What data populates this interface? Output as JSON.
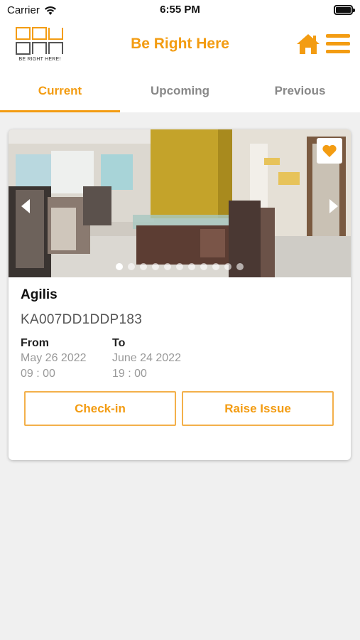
{
  "status_bar": {
    "carrier": "Carrier",
    "time": "6:55 PM"
  },
  "header": {
    "logo_caption": "BE RIGHT HERE!",
    "title": "Be Right Here",
    "home_icon": "home-icon",
    "menu_icon": "hamburger-menu-icon"
  },
  "tabs": [
    {
      "label": "Current",
      "active": true
    },
    {
      "label": "Upcoming",
      "active": false
    },
    {
      "label": "Previous",
      "active": false
    }
  ],
  "booking": {
    "name": "Agilis",
    "id": "KA007DD1DDP183",
    "from_label": "From",
    "from_date": "May 26 2022",
    "from_time": "09 : 00",
    "to_label": "To",
    "to_date": "June 24 2022",
    "to_time": "19 : 00",
    "favorite": true,
    "image_count": 11,
    "active_image": 1
  },
  "actions": {
    "checkin_label": "Check-in",
    "raise_issue_label": "Raise Issue"
  },
  "colors": {
    "accent": "#f39c12",
    "background": "#f0f0f0"
  }
}
